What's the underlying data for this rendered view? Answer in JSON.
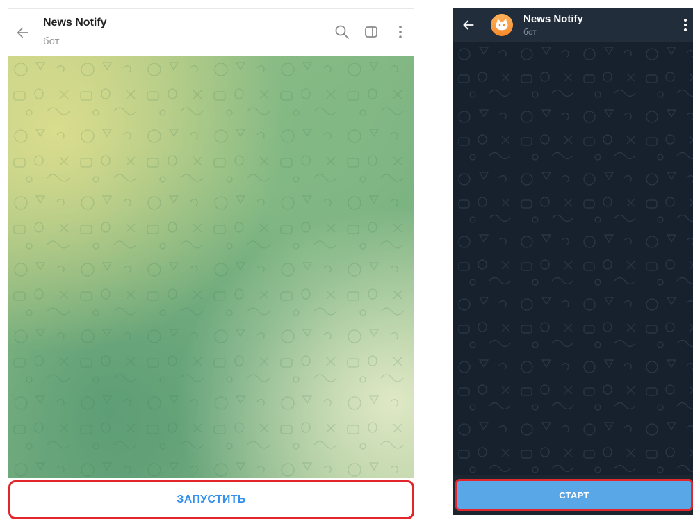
{
  "desktop": {
    "chat_title": "News Notify",
    "chat_subtitle": "бот",
    "start_button_label": "ЗАПУСТИТЬ",
    "icons": [
      "back-arrow-icon",
      "search-icon",
      "sidebar-toggle-icon",
      "more-vertical-icon"
    ],
    "colors": {
      "accent": "#3390ec",
      "highlight": "#e3262b"
    }
  },
  "mobile": {
    "chat_title": "News Notify",
    "chat_subtitle": "бот",
    "start_button_label": "СТАРТ",
    "icons": [
      "back-arrow-icon",
      "bot-avatar-icon",
      "more-vertical-icon"
    ],
    "colors": {
      "header_bg": "#212d3b",
      "button_bg": "#5aa7e8",
      "highlight": "#e3262b"
    }
  }
}
